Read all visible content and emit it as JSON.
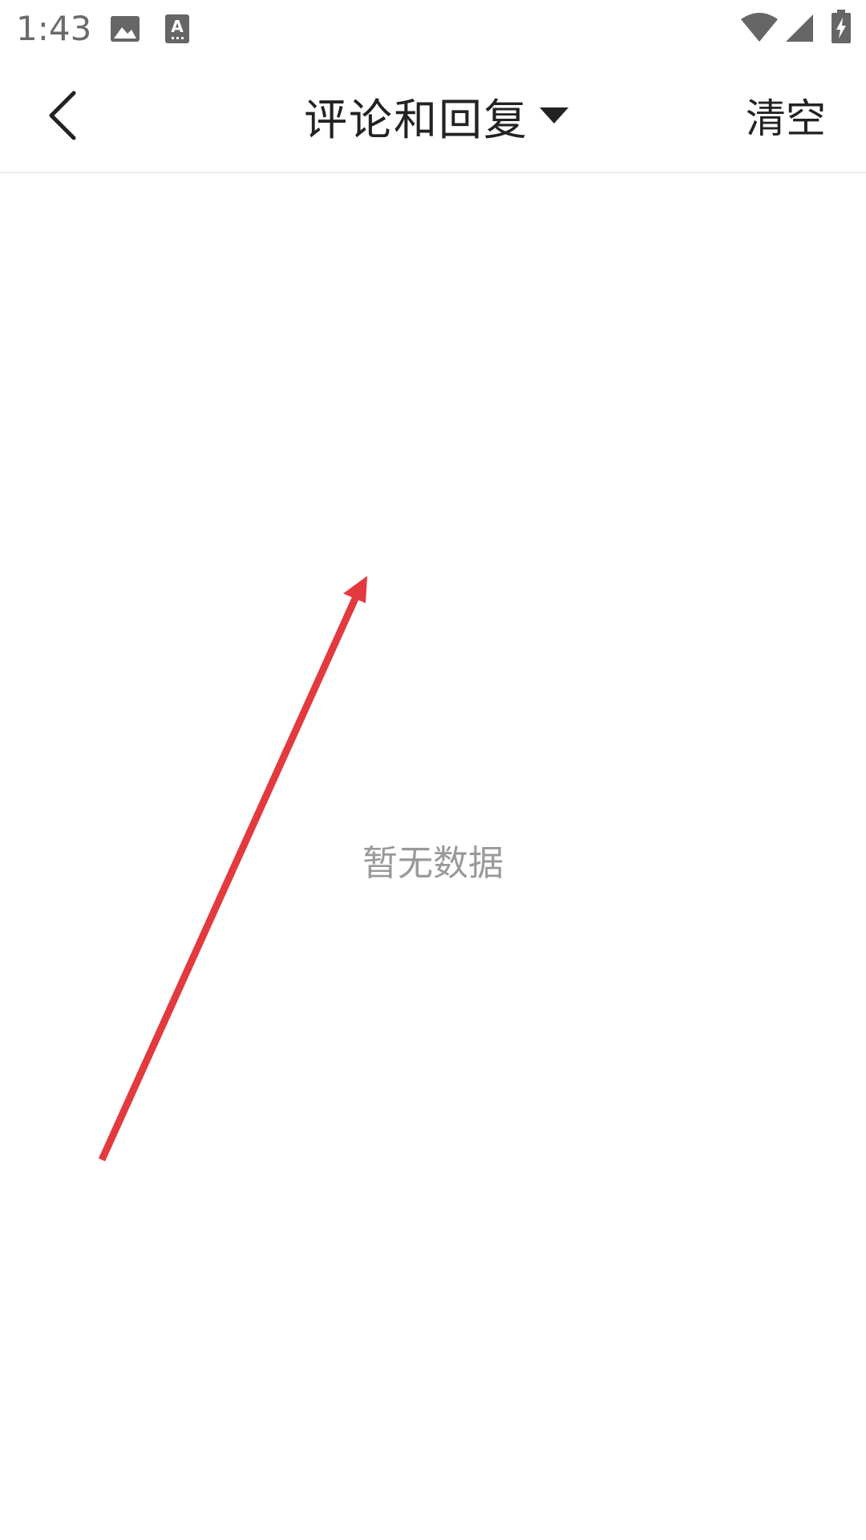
{
  "status_bar": {
    "time": "1:43",
    "icons": [
      "image-icon",
      "text-accessibility-icon",
      "wifi-icon",
      "signal-icon",
      "battery-charging-icon"
    ]
  },
  "app_bar": {
    "back_icon": "chevron-left-icon",
    "title": "评论和回复",
    "title_dropdown_icon": "caret-down-icon",
    "clear_label": "清空"
  },
  "content": {
    "empty_text": "暂无数据"
  },
  "colors": {
    "annotation_arrow": "#e23a3e",
    "title_text": "#222222",
    "empty_text": "#999999"
  }
}
